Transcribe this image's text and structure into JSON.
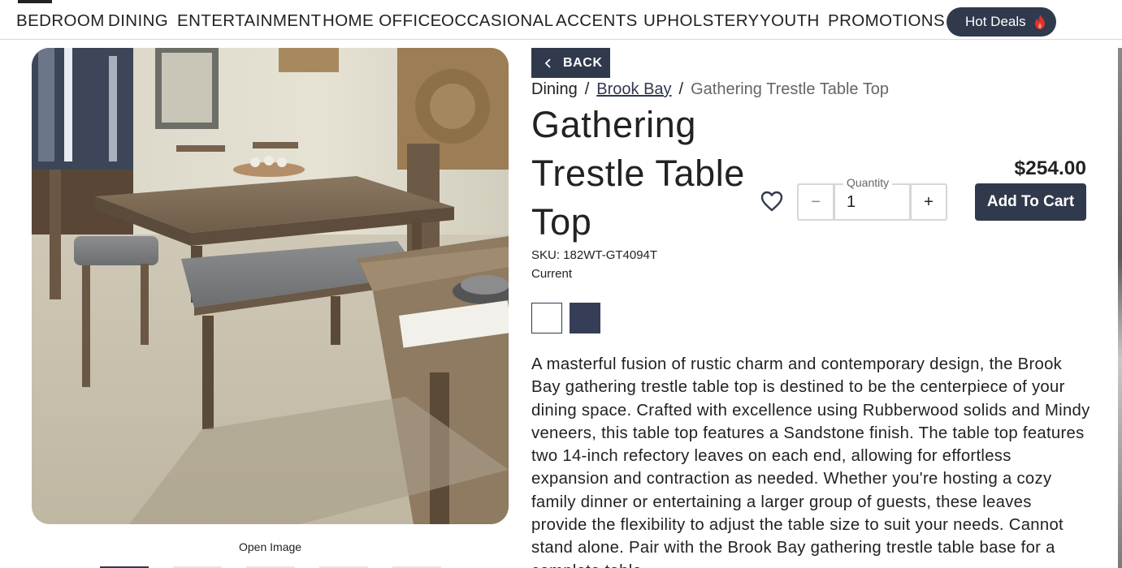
{
  "nav": {
    "items": [
      "BEDROOM",
      "DINING",
      "ENTERTAINMENT",
      "HOME OFFICE",
      "OCCASIONAL",
      "ACCENTS",
      "UPHOLSTERY",
      "YOUTH",
      "PROMOTIONS"
    ],
    "hot_deals": "Hot Deals"
  },
  "gallery": {
    "open_image": "Open Image",
    "thumb_count": 5,
    "active_thumb": 1
  },
  "back_label": "BACK",
  "breadcrumb": {
    "root": "Dining",
    "collection": "Brook Bay",
    "current": "Gathering Trestle Table Top"
  },
  "product": {
    "title": "Gathering Trestle Table Top",
    "sku": "SKU: 182WT-GT4094T",
    "status": "Current",
    "swatch_colors": [
      "#ffffff",
      "#363d57"
    ],
    "description": "A masterful fusion of rustic charm and contemporary design, the Brook Bay gathering trestle table top is destined to be the centerpiece of your dining space. Crafted with excellence using Rubberwood solids and Mindy veneers, this table top features a Sandstone finish. The table top features two 14-inch refectory leaves on each end, allowing for effortless expansion and contraction as needed. Whether you're hosting a cozy family dinner or entertaining a larger group of guests, these leaves provide the flexibility to adjust the table size to suit your needs. Cannot stand alone. Pair with the Brook Bay gathering trestle table base for a complete table."
  },
  "purchase": {
    "quantity_label": "Quantity",
    "quantity_value": "1",
    "minus": "−",
    "plus": "+",
    "price": "$254.00",
    "add_to_cart": "Add To Cart"
  },
  "colors": {
    "brand": "#303a4c",
    "flame": "#e0322b"
  }
}
